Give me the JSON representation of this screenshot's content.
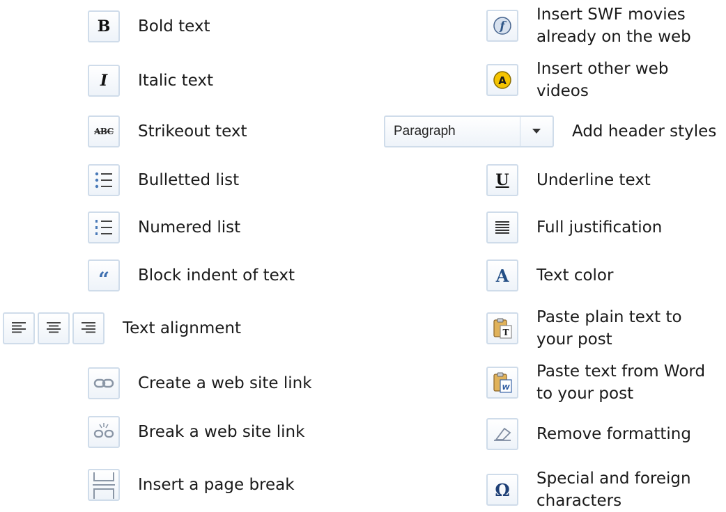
{
  "left": [
    {
      "icon": "bold-icon",
      "label": "Bold text"
    },
    {
      "icon": "italic-icon",
      "label": "Italic text"
    },
    {
      "icon": "strikeout-icon",
      "label": "Strikeout text"
    },
    {
      "icon": "bulleted-list-icon",
      "label": "Bulletted list"
    },
    {
      "icon": "numbered-list-icon",
      "label": "Numered list"
    },
    {
      "icon": "blockquote-icon",
      "label": "Block indent of text"
    },
    {
      "icon": "align-icons",
      "label": "Text alignment"
    },
    {
      "icon": "link-icon",
      "label": "Create a web site link"
    },
    {
      "icon": "unlink-icon",
      "label": "Break a web site link"
    },
    {
      "icon": "page-break-icon",
      "label": "Insert a page break"
    }
  ],
  "right": [
    {
      "icon": "flash-icon",
      "label_1": "Insert SWF movies",
      "label_2": "already on the web"
    },
    {
      "icon": "video-icon",
      "label_1": "Insert other web",
      "label_2": "videos"
    },
    {
      "icon": "format-select",
      "label": "Add header styles",
      "select_value": "Paragraph"
    },
    {
      "icon": "underline-icon",
      "label": "Underline text"
    },
    {
      "icon": "justify-full-icon",
      "label": "Full justification"
    },
    {
      "icon": "text-color-icon",
      "label": "Text color"
    },
    {
      "icon": "paste-text-icon",
      "label_1": "Paste plain text to",
      "label_2": "your post"
    },
    {
      "icon": "paste-word-icon",
      "label_1": "Paste text from Word",
      "label_2": "to your post"
    },
    {
      "icon": "eraser-icon",
      "label": "Remove formatting"
    },
    {
      "icon": "omega-icon",
      "label_1": "Special and foreign",
      "label_2": "characters"
    }
  ]
}
